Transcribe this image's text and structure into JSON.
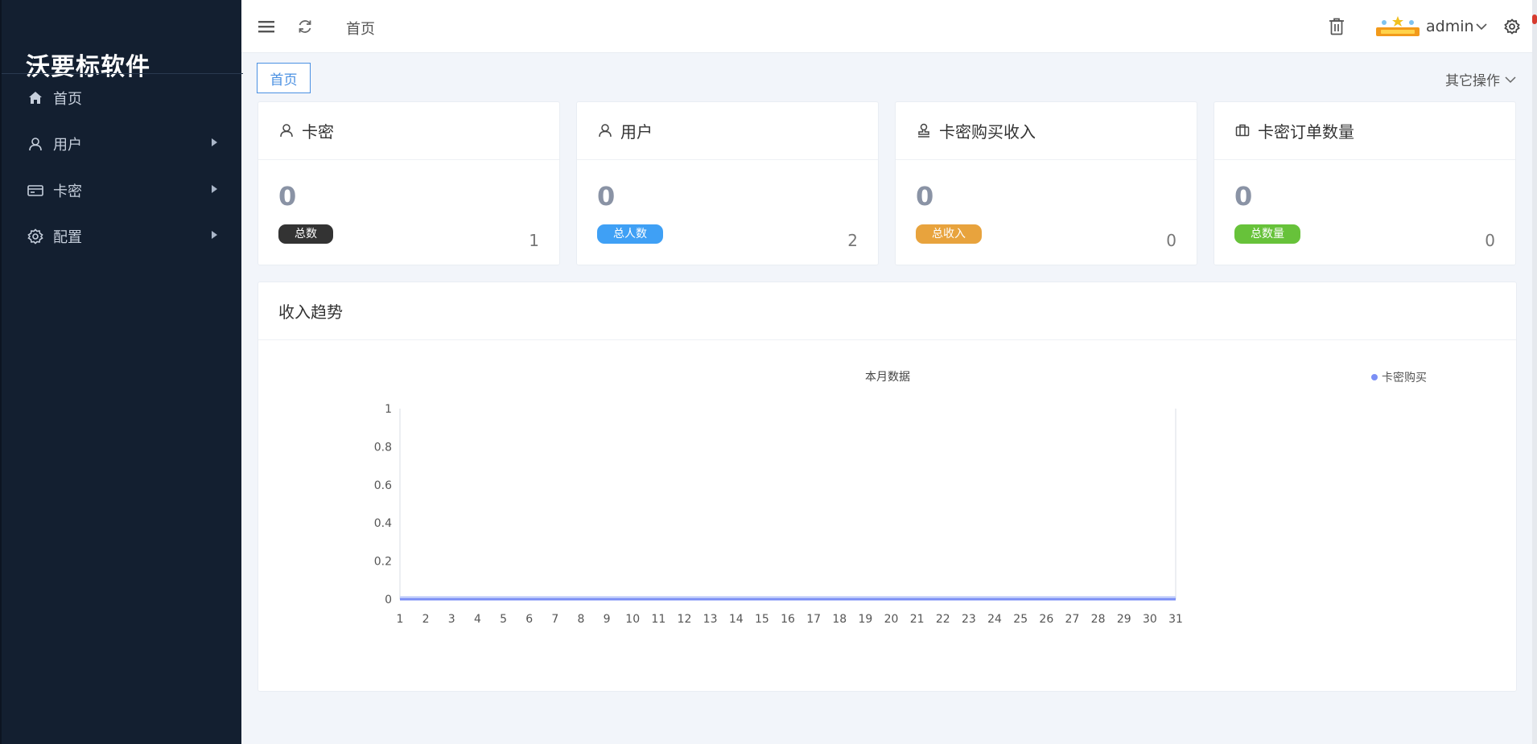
{
  "sidebar": {
    "brand": "沃要标软件",
    "items": [
      {
        "label": "首页",
        "icon": "home-icon",
        "has_children": false
      },
      {
        "label": "用户",
        "icon": "user-icon",
        "has_children": true
      },
      {
        "label": "卡密",
        "icon": "card-icon",
        "has_children": true
      },
      {
        "label": "配置",
        "icon": "gear-icon",
        "has_children": true
      }
    ]
  },
  "topbar": {
    "breadcrumb": "首页",
    "user": "admin",
    "icons": [
      "menu-icon",
      "refresh-icon",
      "trash-icon",
      "logo-badge",
      "gear-icon"
    ]
  },
  "tabs": {
    "active": "首页",
    "other_ops": "其它操作"
  },
  "cards": [
    {
      "title": "卡密",
      "icon": "user-icon",
      "value": "0",
      "badge": "总数",
      "badge_color": "#333333",
      "count": "1"
    },
    {
      "title": "用户",
      "icon": "user-icon",
      "value": "0",
      "badge": "总人数",
      "badge_color": "#3fa0f5",
      "count": "2"
    },
    {
      "title": "卡密购买收入",
      "icon": "stamp-icon",
      "value": "0",
      "badge": "总收入",
      "badge_color": "#e8a33d",
      "count": "0"
    },
    {
      "title": "卡密订单数量",
      "icon": "briefcase-icon",
      "value": "0",
      "badge": "总数量",
      "badge_color": "#67c23a",
      "count": "0"
    }
  ],
  "trend_panel": {
    "title": "收入趋势"
  },
  "chart_data": {
    "type": "area",
    "title": "本月数据",
    "x": [
      1,
      2,
      3,
      4,
      5,
      6,
      7,
      8,
      9,
      10,
      11,
      12,
      13,
      14,
      15,
      16,
      17,
      18,
      19,
      20,
      21,
      22,
      23,
      24,
      25,
      26,
      27,
      28,
      29,
      30,
      31
    ],
    "series": [
      {
        "name": "卡密购买",
        "values": [
          0,
          0,
          0,
          0,
          0,
          0,
          0,
          0,
          0,
          0,
          0,
          0,
          0,
          0,
          0,
          0,
          0,
          0,
          0,
          0,
          0,
          0,
          0,
          0,
          0,
          0,
          0,
          0,
          0,
          0,
          0
        ]
      }
    ],
    "yticks": [
      "0",
      "0.2",
      "0.4",
      "0.6",
      "0.8",
      "1"
    ],
    "ylim": [
      0,
      1
    ],
    "legend": "top-right",
    "series_color": "#7b8ff5"
  }
}
